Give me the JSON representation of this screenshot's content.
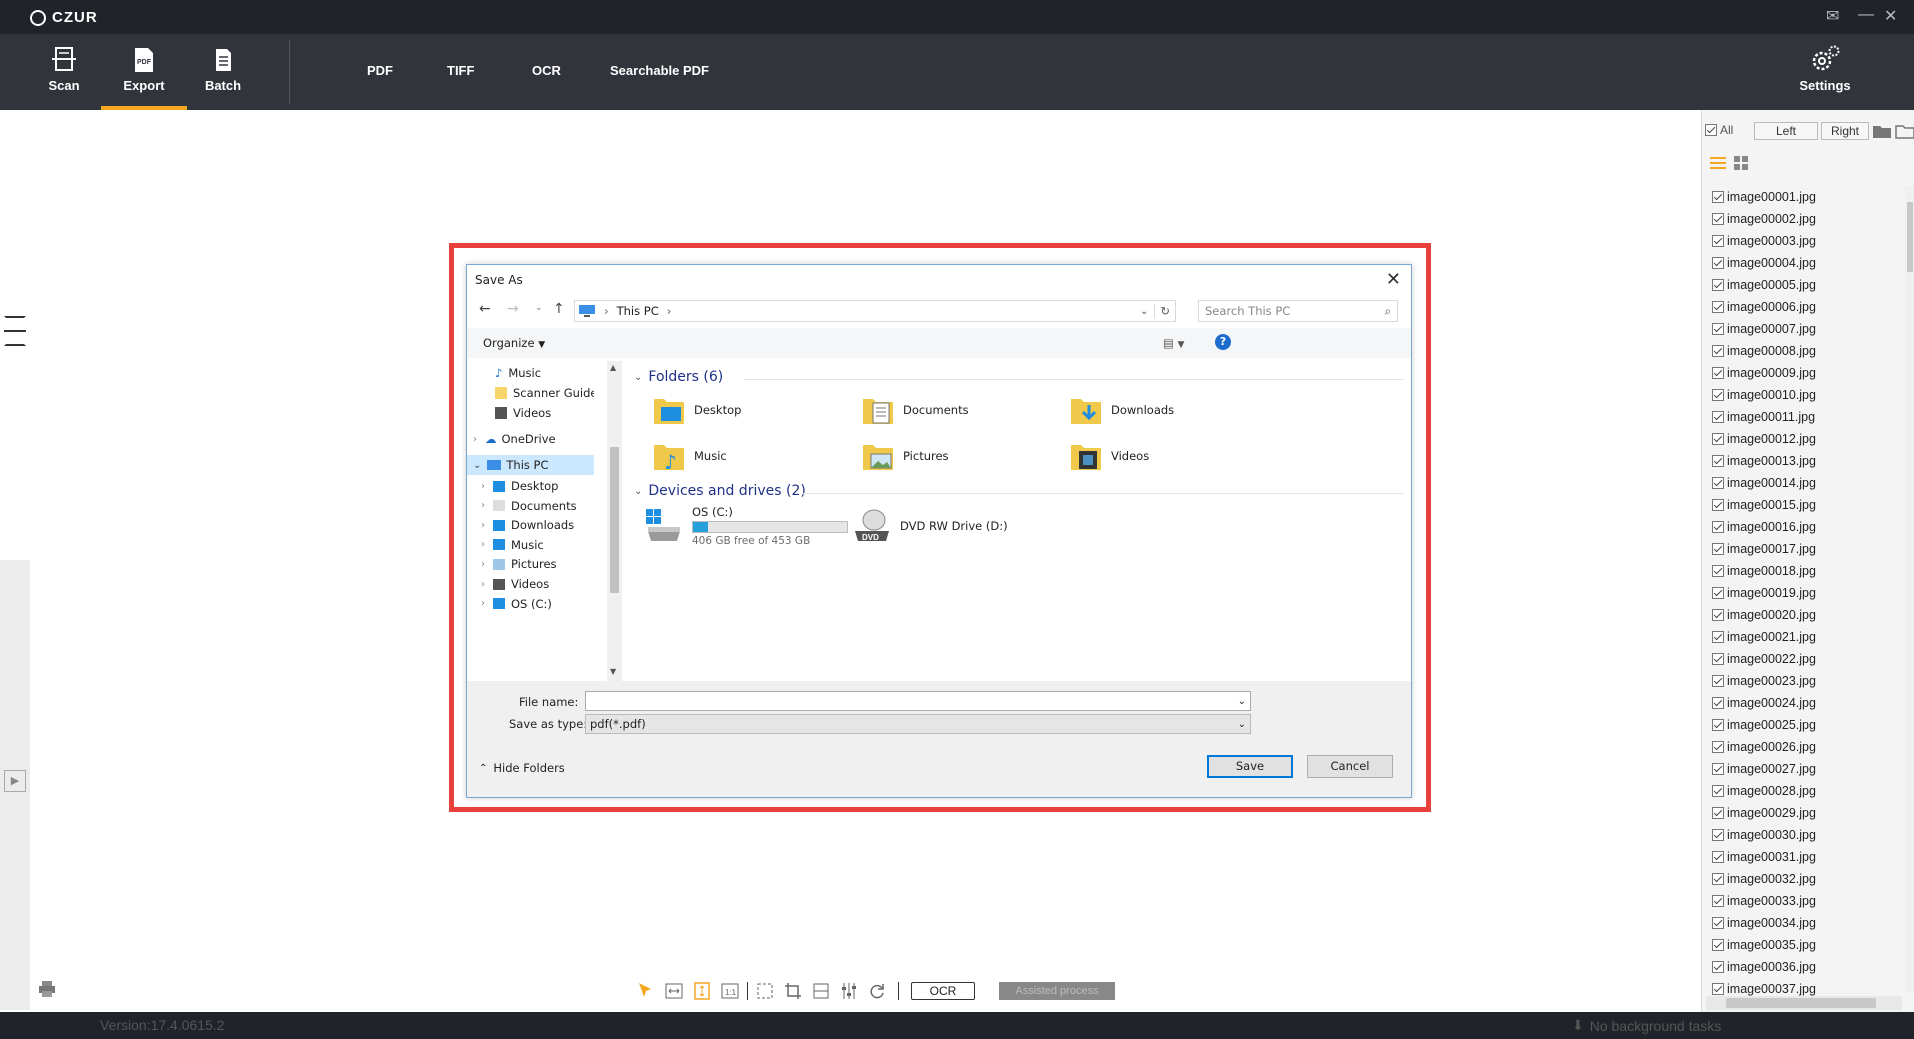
{
  "app": {
    "brand": "CZUR"
  },
  "toolbar": {
    "tools": [
      {
        "label": "Scan",
        "icon": "scan-icon"
      },
      {
        "label": "Export",
        "icon": "pdf-export-icon",
        "active": true
      },
      {
        "label": "Batch",
        "icon": "batch-icon"
      }
    ],
    "formats": [
      "PDF",
      "TIFF",
      "OCR",
      "Searchable PDF"
    ],
    "settings_label": "Settings",
    "accent": "#f5a623"
  },
  "right_panel": {
    "all_label": "All",
    "left_label": "Left",
    "right_label": "Right",
    "files": [
      "image00001.jpg",
      "image00002.jpg",
      "image00003.jpg",
      "image00004.jpg",
      "image00005.jpg",
      "image00006.jpg",
      "image00007.jpg",
      "image00008.jpg",
      "image00009.jpg",
      "image00010.jpg",
      "image00011.jpg",
      "image00012.jpg",
      "image00013.jpg",
      "image00014.jpg",
      "image00015.jpg",
      "image00016.jpg",
      "image00017.jpg",
      "image00018.jpg",
      "image00019.jpg",
      "image00020.jpg",
      "image00021.jpg",
      "image00022.jpg",
      "image00023.jpg",
      "image00024.jpg",
      "image00025.jpg",
      "image00026.jpg",
      "image00027.jpg",
      "image00028.jpg",
      "image00029.jpg",
      "image00030.jpg",
      "image00031.jpg",
      "image00032.jpg",
      "image00033.jpg",
      "image00034.jpg",
      "image00035.jpg",
      "image00036.jpg",
      "image00037.jpg"
    ]
  },
  "bottom_tools": {
    "ocr_label": "OCR",
    "assist_label": "Assisted process"
  },
  "status": {
    "version": "Version:17.4.0615.2",
    "tasks": "No background tasks"
  },
  "dialog": {
    "title": "Save As",
    "path": "This PC",
    "search_placeholder": "Search This PC",
    "organize_label": "Organize",
    "nav": {
      "quick": [
        "Music",
        "Scanner Guide Ir",
        "Videos"
      ],
      "onedrive": "OneDrive",
      "this_pc": "This PC",
      "pc_children": [
        "Desktop",
        "Documents",
        "Downloads",
        "Music",
        "Pictures",
        "Videos",
        "OS (C:)"
      ]
    },
    "folders_header": "Folders (6)",
    "folders": [
      "Desktop",
      "Documents",
      "Downloads",
      "Music",
      "Pictures",
      "Videos"
    ],
    "devices_header": "Devices and drives (2)",
    "drives": [
      {
        "name": "OS (C:)",
        "free": "406 GB free of 453 GB",
        "used_fraction": 0.1
      },
      {
        "name": "DVD RW Drive (D:)",
        "dvd_label": "DVD"
      }
    ],
    "filename_label": "File name:",
    "filename_value": "",
    "savetype_label": "Save as type:",
    "savetype_value": "pdf(*.pdf)",
    "hide_folders": "Hide Folders",
    "save_label": "Save",
    "cancel_label": "Cancel"
  }
}
